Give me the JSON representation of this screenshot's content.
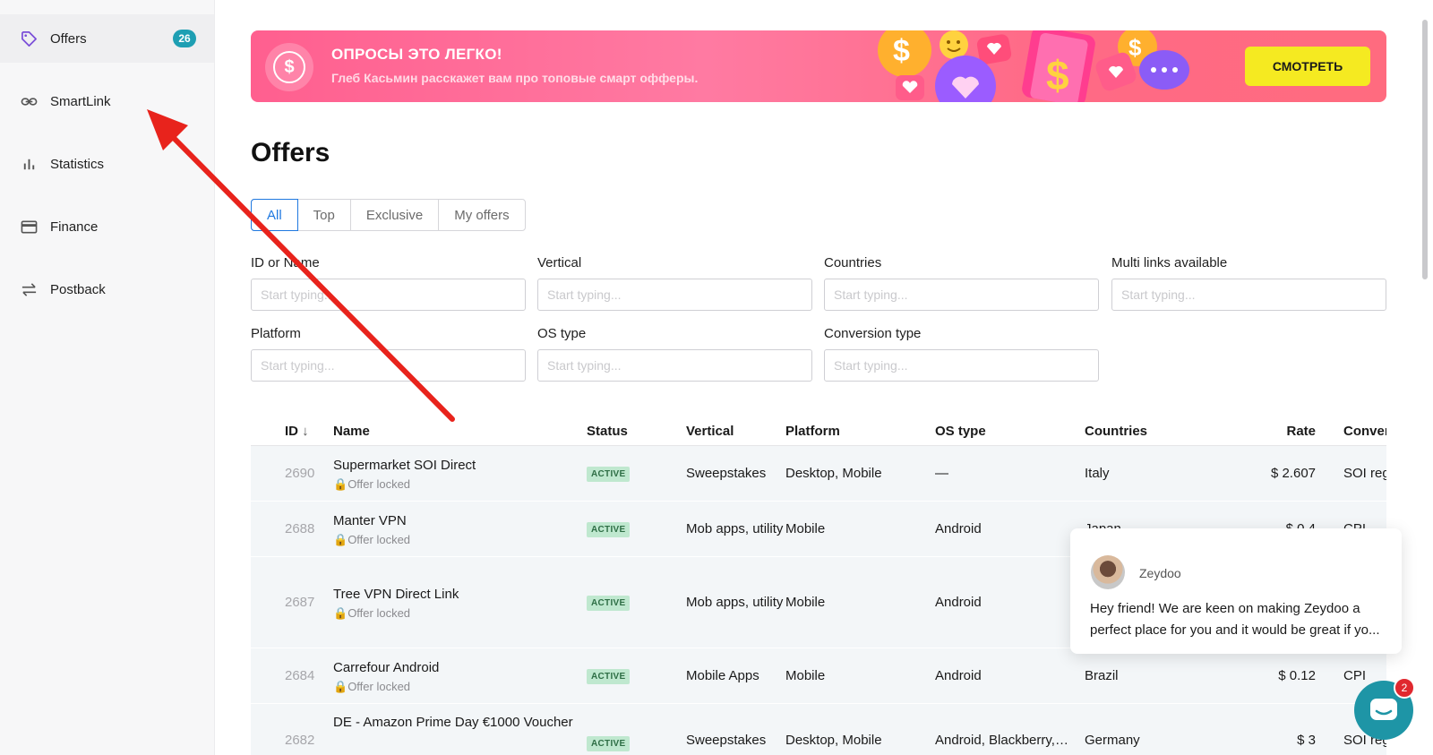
{
  "sidebar": {
    "items": [
      {
        "label": "Offers",
        "icon": "tag-icon",
        "badge": "26",
        "active": true
      },
      {
        "label": "SmartLink",
        "icon": "link-icon"
      },
      {
        "label": "Statistics",
        "icon": "bar-chart-icon"
      },
      {
        "label": "Finance",
        "icon": "credit-card-icon"
      },
      {
        "label": "Postback",
        "icon": "swap-arrows-icon"
      }
    ]
  },
  "banner": {
    "title": "ОПРОСЫ ЭТО ЛЕГКО!",
    "subtitle": "Глеб Касьмин расскажет вам про топовые смарт офферы.",
    "cta": "СМОТРЕТЬ",
    "coin_symbol": "$",
    "accent": "#ff6a90",
    "cta_color": "#f5ea21"
  },
  "page": {
    "title": "Offers"
  },
  "tabs": [
    "All",
    "Top",
    "Exclusive",
    "My offers"
  ],
  "filters": [
    {
      "label": "ID or Name",
      "placeholder": "Start typing..."
    },
    {
      "label": "Vertical",
      "placeholder": "Start typing..."
    },
    {
      "label": "Countries",
      "placeholder": "Start typing..."
    },
    {
      "label": "Multi links available",
      "placeholder": "Start typing..."
    },
    {
      "label": "Platform",
      "placeholder": "Start typing..."
    },
    {
      "label": "OS type",
      "placeholder": "Start typing..."
    },
    {
      "label": "Conversion type",
      "placeholder": "Start typing..."
    }
  ],
  "table": {
    "headers": {
      "id": "ID",
      "sort_icon": "↓",
      "name": "Name",
      "status": "Status",
      "vertical": "Vertical",
      "platform": "Platform",
      "os": "OS type",
      "countries": "Countries",
      "rate": "Rate",
      "conversion": "Convers"
    },
    "rows": [
      {
        "id": "2690",
        "name": "Supermarket SOI Direct",
        "lock": "Offer locked",
        "status": "ACTIVE",
        "vertical": "Sweepstakes",
        "platform": "Desktop, Mobile",
        "os": "—",
        "countries": "Italy",
        "rate": "$ 2.607",
        "conversion": "SOI regis"
      },
      {
        "id": "2688",
        "name": "Manter VPN",
        "lock": "Offer locked",
        "status": "ACTIVE",
        "vertical": "Mob apps, utility",
        "platform": "Mobile",
        "os": "Android",
        "countries": "Japan",
        "rate": "$ 0.4",
        "conversion": "CPI"
      },
      {
        "id": "2687",
        "name": "Tree VPN Direct Link",
        "lock": "Offer locked",
        "status": "ACTIVE",
        "vertical": "Mob apps, utility",
        "platform": "Mobile",
        "os": "Android",
        "countries": "",
        "rate": "",
        "conversion": ""
      },
      {
        "id": "2684",
        "name": "Carrefour Android",
        "lock": "Offer locked",
        "status": "ACTIVE",
        "vertical": "Mobile Apps",
        "platform": "Mobile",
        "os": "Android",
        "countries": "Brazil",
        "rate": "$ 0.12",
        "conversion": "CPI"
      },
      {
        "id": "2682",
        "name": "DE - Amazon Prime Day €1000 Voucher",
        "lock": "",
        "status": "ACTIVE",
        "vertical": "Sweepstakes",
        "platform": "Desktop, Mobile",
        "os": "Android, Blackberry,…",
        "countries": "Germany",
        "rate": "$ 3",
        "conversion": "SOI regis"
      }
    ]
  },
  "chat": {
    "sender": "Zeydoo",
    "message": "Hey friend!  We are keen on making Zeydoo a perfect place for you and it would be great if yo..."
  },
  "launcher": {
    "badge": "2"
  },
  "colors": {
    "status_bg": "#bfe8cf",
    "badge": "#1e9fb3",
    "arrow": "#e8231c",
    "tab_active": "#1f78e0"
  }
}
